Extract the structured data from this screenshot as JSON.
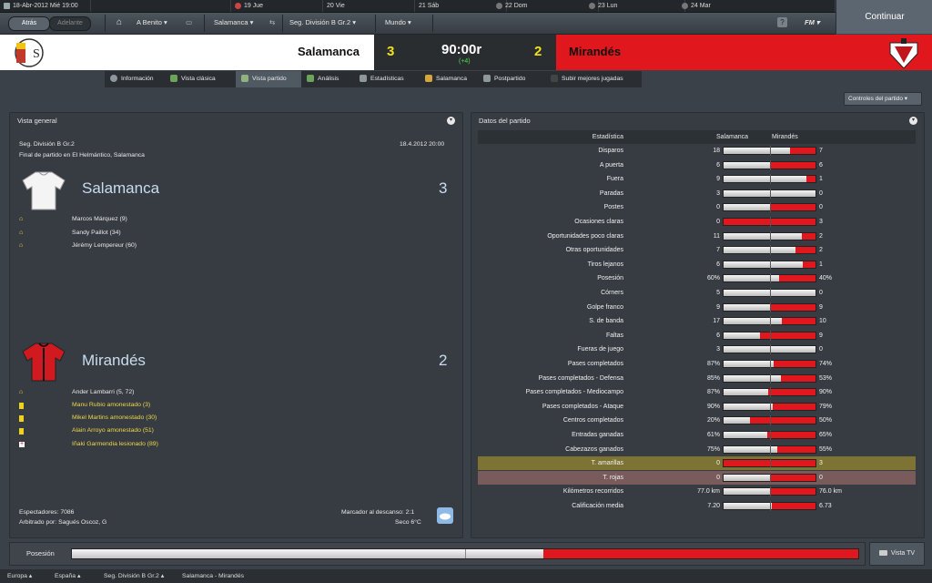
{
  "calendar": {
    "current_date": "18-Abr-2012  Mié 19:00",
    "days": [
      {
        "label": "19 Jue"
      },
      {
        "label": "20 Vie"
      },
      {
        "label": "21 Sáb"
      },
      {
        "label": "22 Dom"
      },
      {
        "label": "23 Lun"
      },
      {
        "label": "24 Mar"
      }
    ]
  },
  "nav": {
    "back": "Atrás",
    "forward": "Adelante",
    "home_user": "A Benito",
    "team": "Salamanca",
    "competition": "Seg. División B Gr.2",
    "world": "Mundo",
    "help": "?",
    "fm_menu": "FM",
    "continue": "Continuar"
  },
  "scoreboard": {
    "home_team": "Salamanca",
    "home_score": "3",
    "time": "90:00r",
    "added": "(+4)",
    "away_score": "2",
    "away_team": "Mirandés"
  },
  "tabs": [
    {
      "label": "Información",
      "icon": "info-icon"
    },
    {
      "label": "Vista clásica",
      "icon": "classic-view-icon"
    },
    {
      "label": "Vista partido",
      "icon": "match-view-icon",
      "active": true
    },
    {
      "label": "Análisis",
      "icon": "analysis-icon"
    },
    {
      "label": "Estadísticas",
      "icon": "stats-icon"
    },
    {
      "label": "Salamanca",
      "icon": "team-icon"
    },
    {
      "label": "Postpartido",
      "icon": "postmatch-icon"
    },
    {
      "label": "Subir mejores jugadas",
      "icon": "upload-icon"
    }
  ],
  "controls_button": "Controles del partido",
  "overview": {
    "title": "Vista general",
    "competition": "Seg. División B Gr.2",
    "datetime": "18.4.2012 20:00",
    "venue": "Final de partido en El Helmántico, Salamanca",
    "home_team": "Salamanca",
    "home_score": "3",
    "home_events": [
      {
        "text": "Marcos Márquez (9)",
        "type": "goal"
      },
      {
        "text": "Sandy Paillot (34)",
        "type": "goal"
      },
      {
        "text": "Jérémy Lempereur (60)",
        "type": "goal"
      }
    ],
    "away_team": "Mirandés",
    "away_score": "2",
    "away_events": [
      {
        "text": "Ander Lambarri (5, 72)",
        "type": "goal"
      },
      {
        "text": "Manu Rubio amonestado (3)",
        "type": "yellow"
      },
      {
        "text": "Mikel Martins amonestado (30)",
        "type": "yellow"
      },
      {
        "text": "Alain Arroyo amonestado (51)",
        "type": "yellow"
      },
      {
        "text": "Iñaki Garmendia lesionado (89)",
        "type": "injury"
      }
    ],
    "attendance": "Espectadores: 7086",
    "referee": "Arbitrado por: Sagués Oscoz, G",
    "halftime": "Marcador al descanso: 2:1",
    "weather": "Seco 6°C"
  },
  "stats": {
    "title": "Datos del partido",
    "col_stat": "Estadística",
    "col_home": "Salamanca",
    "col_away": "Mirandés",
    "rows": [
      {
        "label": "Disparos",
        "home": "18",
        "away": "7",
        "home_share": 0.72
      },
      {
        "label": "A puerta",
        "home": "6",
        "away": "6",
        "home_share": 0.5
      },
      {
        "label": "Fuera",
        "home": "9",
        "away": "1",
        "home_share": 0.9
      },
      {
        "label": "Paradas",
        "home": "3",
        "away": "0",
        "home_share": 1.0
      },
      {
        "label": "Postes",
        "home": "0",
        "away": "0",
        "home_share": 0.5
      },
      {
        "label": "Ocasiones claras",
        "home": "0",
        "away": "3",
        "home_share": 0.0
      },
      {
        "label": "Oportunidades poco claras",
        "home": "11",
        "away": "2",
        "home_share": 0.85
      },
      {
        "label": "Otras oportunidades",
        "home": "7",
        "away": "2",
        "home_share": 0.78
      },
      {
        "label": "Tiros lejanos",
        "home": "6",
        "away": "1",
        "home_share": 0.86
      },
      {
        "label": "Posesión",
        "home": "60%",
        "away": "40%",
        "home_share": 0.6
      },
      {
        "label": "Córners",
        "home": "5",
        "away": "0",
        "home_share": 1.0
      },
      {
        "label": "Golpe franco",
        "home": "9",
        "away": "9",
        "home_share": 0.5
      },
      {
        "label": "S. de banda",
        "home": "17",
        "away": "10",
        "home_share": 0.63
      },
      {
        "label": "Faltas",
        "home": "6",
        "away": "9",
        "home_share": 0.4
      },
      {
        "label": "Fueras de juego",
        "home": "3",
        "away": "0",
        "home_share": 1.0
      },
      {
        "label": "Pases completados",
        "home": "87%",
        "away": "74%",
        "home_share": 0.54
      },
      {
        "label": "Pases completados - Defensa",
        "home": "85%",
        "away": "53%",
        "home_share": 0.62
      },
      {
        "label": "Pases completados - Mediocampo",
        "home": "87%",
        "away": "90%",
        "home_share": 0.49
      },
      {
        "label": "Pases completados - Ataque",
        "home": "90%",
        "away": "79%",
        "home_share": 0.53
      },
      {
        "label": "Centros completados",
        "home": "20%",
        "away": "50%",
        "home_share": 0.29
      },
      {
        "label": "Entradas ganadas",
        "home": "61%",
        "away": "65%",
        "home_share": 0.48
      },
      {
        "label": "Cabezazos ganados",
        "home": "75%",
        "away": "55%",
        "home_share": 0.58
      },
      {
        "label": "T. amarillas",
        "home": "0",
        "away": "3",
        "home_share": 0.0,
        "highlight": "#7d7434"
      },
      {
        "label": "T. rojas",
        "home": "0",
        "away": "0",
        "home_share": 0.5,
        "highlight": "#7a5b5b"
      },
      {
        "label": "Kilómetros recorridos",
        "home": "77.0 km",
        "away": "76.0 km",
        "home_share": 0.5
      },
      {
        "label": "Calificación media",
        "home": "7.20",
        "away": "6.73",
        "home_share": 0.52
      }
    ]
  },
  "possession": {
    "label": "Posesión",
    "home_share": 0.6
  },
  "vista_tv": "Vista TV",
  "breadcrumbs": [
    "Europa",
    "España",
    "Seg. División B Gr.2",
    "Salamanca - Mirandés"
  ]
}
